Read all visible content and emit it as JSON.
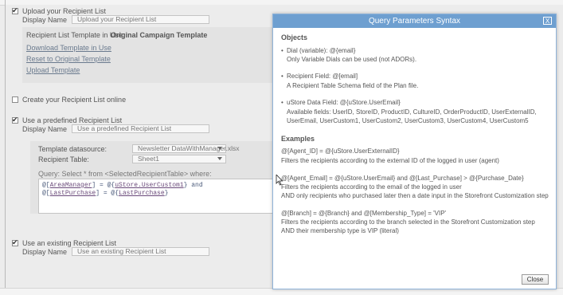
{
  "upload": {
    "checkbox_label": "Upload your Recipient List",
    "display_name_label": "Display Name",
    "display_name_value": "Upload your Recipient List",
    "template_in_use_label": "Recipient List Template in Use:",
    "template_in_use_value": "Original Campaign Template",
    "download_link": "Download Template in Use",
    "reset_link": "Reset to Original Template",
    "upload_link": "Upload Template"
  },
  "create_online": {
    "checkbox_label": "Create your Recipient List online"
  },
  "predefined": {
    "checkbox_label": "Use a predefined Recipient List",
    "display_name_label": "Display Name",
    "display_name_value": "Use a predefined Recipient List",
    "datasource_label": "Template datasource:",
    "datasource_value": "Newsletter DataWithManager.xlsx",
    "table_label": "Recipient Table:",
    "table_value": "Sheet1",
    "query_label": "Query: Select * from <SelectedRecipientTable> where:",
    "query_line1_a": "@[",
    "query_line1_b": "AreaManager",
    "query_line1_c": "] = @{",
    "query_line1_d": "uStore.UserCustom1",
    "query_line1_e": "} and",
    "query_line2_a": "@[",
    "query_line2_b": "LastPurchase",
    "query_line2_c": "] = @{",
    "query_line2_d": "LastPurchase",
    "query_line2_e": "}"
  },
  "existing": {
    "checkbox_label": "Use an existing Recipient List",
    "display_name_label": "Display Name",
    "display_name_value": "Use an existing Recipient List"
  },
  "modal": {
    "title": "Query Parameters Syntax",
    "close_x": "X",
    "objects_heading": "Objects",
    "dial_title": "Dial (variable): @{email}",
    "dial_desc": "Only Variable Dials can be used (not ADORs).",
    "recipient_title": "Recipient Field: @[email]",
    "recipient_desc": "A Recipient Table Schema field of the Plan file.",
    "ustore_title": "uStore Data Field: @{uStore.UserEmail}",
    "ustore_desc1": "Available fields: UserID, StoreID, ProductID, CultureID, OrderProductID, UserExternalID,",
    "ustore_desc2": "UserEmail, UserCustom1, UserCustom2, UserCustom3, UserCustom4, UserCustom5",
    "examples_heading": "Examples",
    "ex1_title": "@[Agent_ID] = @{uStore.UserExternalID}",
    "ex1_desc": "Filters the recipients according to the external ID of the logged in user (agent)",
    "ex2_title": "@[Agent_Email] = @{uStore.UserEmail} and @[Last_Purchase] > @{Purchase_Date}",
    "ex2_desc1": "Filters the recipients according to the email of the logged in user",
    "ex2_desc2": "AND only recipients who purchased later then a date input in the Storefront Customization step",
    "ex3_title": "@[Branch] = @{Branch} and @[Membership_Type] = 'VIP'",
    "ex3_desc1": "Filters the recipients according to the branch selected in the Storefront Customization step",
    "ex3_desc2": "AND their membership type is VIP (literal)",
    "close_button": "Close",
    "bullet": "•"
  },
  "colors": {
    "modal_title_bar": "#6e9fd0",
    "link": "#6a7a8e"
  }
}
